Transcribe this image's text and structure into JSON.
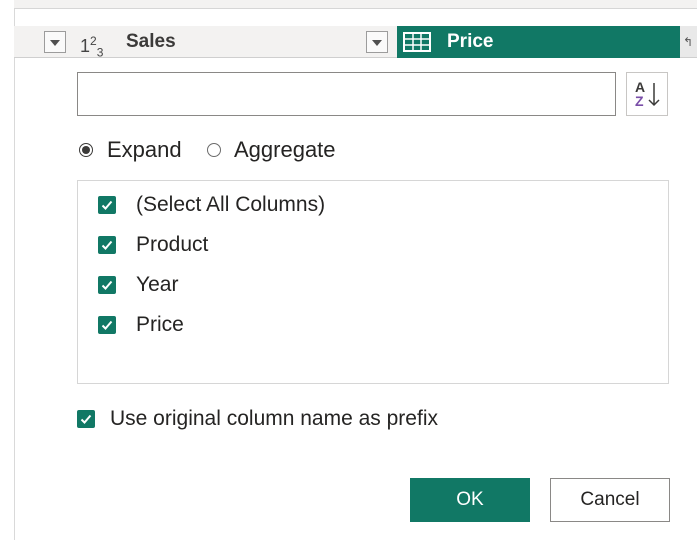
{
  "columns": {
    "sales": {
      "type_icon": "number-type-icon",
      "name": "Sales"
    },
    "price": {
      "type_icon": "table-type-icon",
      "name": "Price"
    }
  },
  "search": {
    "value": "",
    "placeholder": ""
  },
  "mode": {
    "expand_label": "Expand",
    "aggregate_label": "Aggregate",
    "selected": "Expand"
  },
  "column_list": [
    {
      "label": "(Select All Columns)",
      "checked": true
    },
    {
      "label": "Product",
      "checked": true
    },
    {
      "label": "Year",
      "checked": true
    },
    {
      "label": "Price",
      "checked": true
    }
  ],
  "prefix_option": {
    "label": "Use original column name as prefix",
    "checked": true
  },
  "buttons": {
    "ok": "OK",
    "cancel": "Cancel"
  },
  "colors": {
    "accent": "#117865",
    "header_bg": "#f3f2f1",
    "border": "#8a8886"
  }
}
